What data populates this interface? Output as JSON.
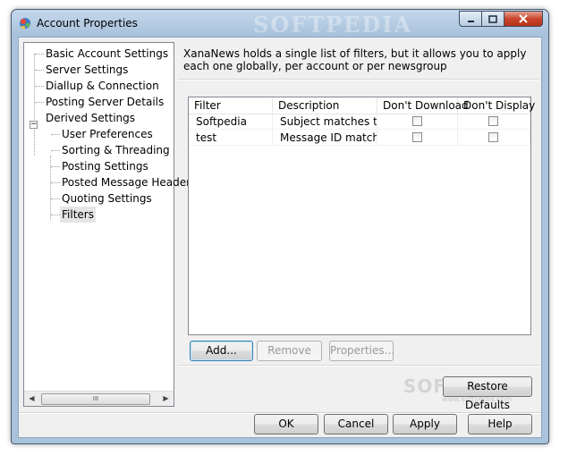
{
  "window": {
    "title": "Account Properties",
    "watermark": "SOFTPEDIA"
  },
  "tree": {
    "items": [
      {
        "label": "Basic Account Settings"
      },
      {
        "label": "Server Settings"
      },
      {
        "label": "Diallup & Connection"
      },
      {
        "label": "Posting Server Details"
      },
      {
        "label": "Derived Settings",
        "expander": "−"
      },
      {
        "label": "User Preferences"
      },
      {
        "label": "Sorting & Threading"
      },
      {
        "label": "Posting Settings"
      },
      {
        "label": "Posted Message Headers"
      },
      {
        "label": "Quoting Settings"
      },
      {
        "label": "Filters",
        "selected": true
      }
    ],
    "scroll_grip": "III"
  },
  "filters": {
    "description": "XanaNews holds a single list of filters, but it allows you to apply each one globally, per account or per newsgroup",
    "columns": [
      "Filter",
      "Description",
      "Don't Download",
      "Don't Display"
    ],
    "rows": [
      {
        "filter": "Softpedia",
        "description": "Subject matches test",
        "dont_download": false,
        "dont_display": false
      },
      {
        "filter": "test",
        "description": "Message ID match...",
        "dont_download": false,
        "dont_display": false
      }
    ],
    "add_label": "Add...",
    "remove_label": "Remove",
    "properties_label": "Properties...",
    "restore_label": "Restore Defaults"
  },
  "watermark2": {
    "text": "SOFTPEDIA",
    "url": "www.softpedia.com"
  },
  "footer": {
    "ok_label": "OK",
    "cancel_label": "Cancel",
    "apply_label": "Apply",
    "help_label": "Help"
  }
}
